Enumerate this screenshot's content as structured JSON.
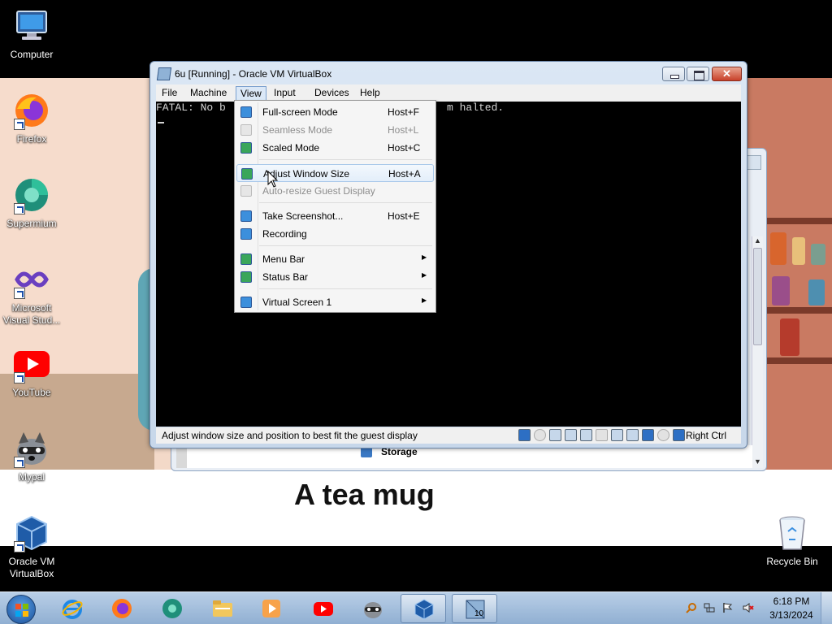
{
  "wallpaper": {
    "caption": "A tea mug"
  },
  "desktop_icons": [
    {
      "label": "Computer",
      "icon": "computer-icon"
    },
    {
      "label": "Firefox",
      "icon": "firefox-icon"
    },
    {
      "label": "Supermium",
      "icon": "supermium-icon"
    },
    {
      "label": "Microsoft Visual Stud...",
      "icon": "visual-studio-icon"
    },
    {
      "label": "YouTube",
      "icon": "youtube-icon"
    },
    {
      "label": "Mypal",
      "icon": "mypal-icon"
    },
    {
      "label": "Oracle VM VirtualBox",
      "icon": "virtualbox-icon"
    },
    {
      "label": "Recycle Bin",
      "icon": "recycle-bin-icon"
    }
  ],
  "background_window": {
    "storage_label": "Storage"
  },
  "vm_window": {
    "title": "6u [Running] - Oracle VM VirtualBox",
    "menu": [
      "File",
      "Machine",
      "View",
      "Input",
      "Devices",
      "Help"
    ],
    "active_menu": "View",
    "console_line_start": "FATAL: No b",
    "console_line_end": "m halted.",
    "status_text": "Adjust window size and position to best fit the guest display",
    "host_key": "Right Ctrl"
  },
  "view_menu": {
    "items": [
      {
        "label": "Full-screen Mode",
        "shortcut": "Host+F",
        "enabled": true,
        "submenu": false
      },
      {
        "label": "Seamless Mode",
        "shortcut": "Host+L",
        "enabled": false,
        "submenu": false
      },
      {
        "label": "Scaled Mode",
        "shortcut": "Host+C",
        "enabled": true,
        "submenu": false
      },
      {
        "label": "Adjust Window Size",
        "shortcut": "Host+A",
        "enabled": true,
        "submenu": false,
        "hovered": true
      },
      {
        "label": "Auto-resize Guest Display",
        "shortcut": "",
        "enabled": false,
        "submenu": false
      },
      {
        "label": "Take Screenshot...",
        "shortcut": "Host+E",
        "enabled": true,
        "submenu": false
      },
      {
        "label": "Recording",
        "shortcut": "",
        "enabled": true,
        "submenu": false
      },
      {
        "label": "Menu Bar",
        "shortcut": "",
        "enabled": true,
        "submenu": true
      },
      {
        "label": "Status Bar",
        "shortcut": "",
        "enabled": true,
        "submenu": true
      },
      {
        "label": "Virtual Screen 1",
        "shortcut": "",
        "enabled": true,
        "submenu": true
      }
    ]
  },
  "taskbar": {
    "pinned": [
      "internet-explorer-icon",
      "firefox-icon",
      "supermium-icon",
      "file-explorer-icon",
      "media-player-icon",
      "youtube-icon",
      "mypal-icon",
      "virtualbox-icon",
      "vm-window-icon"
    ],
    "vm_badge": "10",
    "clock_time": "6:18 PM",
    "clock_date": "3/13/2024"
  },
  "colors": {
    "menu_hover": "#e3eefa",
    "title_bar": "#c7d7ea",
    "taskbar": "#90afd2"
  }
}
